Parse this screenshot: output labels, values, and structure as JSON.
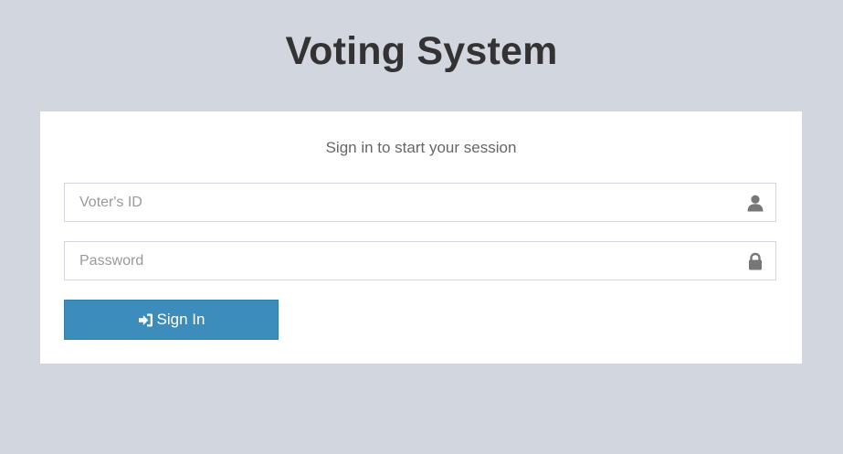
{
  "header": {
    "title": "Voting System"
  },
  "login": {
    "message": "Sign in to start your session",
    "voter_id": {
      "placeholder": "Voter's ID",
      "value": "",
      "icon": "user-icon"
    },
    "password": {
      "placeholder": "Password",
      "value": "",
      "icon": "lock-icon"
    },
    "submit": {
      "label": "Sign In",
      "icon": "sign-in-icon"
    }
  },
  "colors": {
    "background": "#d2d6de",
    "panel": "#ffffff",
    "primary": "#3c8dbc",
    "title_text": "#333333",
    "message_text": "#666666",
    "icon": "#777777"
  }
}
